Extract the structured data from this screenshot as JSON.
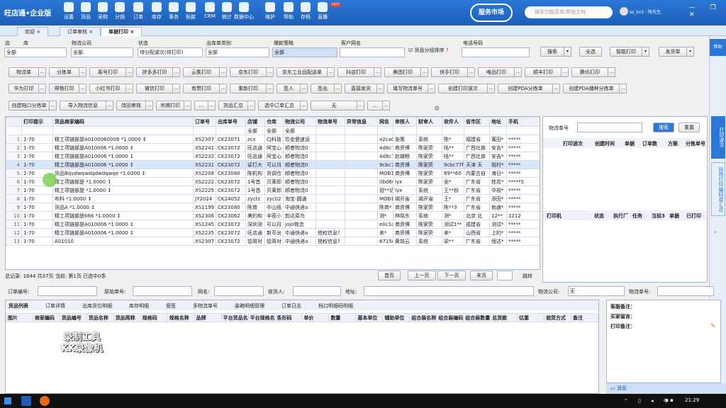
{
  "app": {
    "logo": "旺店通•企业版",
    "hot_badge": "HOT",
    "service_badge": "服务市场",
    "search_placeholder": "搜索功能菜单/帮助文档",
    "user": "ss_kn2 · 陈先生",
    "window_controls": "— ❐ ✕"
  },
  "nav": [
    "设置",
    "货品",
    "采购",
    "分销",
    "订单",
    "库存",
    "事务",
    "账款",
    "CRM",
    "统计",
    "数据中心",
    "维护",
    "帮助",
    "存档",
    "直播"
  ],
  "tabs": [
    "欢迎",
    "订单审核",
    "单据打印"
  ],
  "filters": {
    "shop_label": "店",
    "shop_value": "全部",
    "warehouse_label": "库",
    "courier_label": "物流公司",
    "courier_value": "全部",
    "status_label": "状态",
    "status_value": "待分配波次(待打印)",
    "out_type_label": "出库单类别",
    "out_type_value": "全部",
    "strategy_label": "爆款策略",
    "strategy_value": "全部",
    "customer_label": "客户网名",
    "customer_value": "",
    "group_sort": "货品分组排序",
    "phone_label": "电话号码",
    "phone_value": ""
  },
  "top_buttons": [
    "搜索",
    "全选",
    "智能打印",
    "发货单",
    "帮助"
  ],
  "btnrow1": [
    "物流单",
    "分拣单",
    "筹号打印",
    "拼多多打印",
    "云集打印",
    "京东打印",
    "京东工业品配送单",
    "抖店打印",
    "美团打印",
    "快手打印",
    "唯品打印",
    "顺丰打印",
    "腾讯打印"
  ],
  "btnrow2": [
    "华为打印",
    "得物打印",
    "小红书打印",
    "微信打印",
    "有赞打印",
    "重新打印",
    "签入",
    "签出",
    "直接发货",
    "填写物流单号",
    "创建打印波次",
    "创建PDA分拣单",
    "创建PDA播种分拣单"
  ],
  "btnrow3": [
    "创建档口分拣单",
    "导入物流信息",
    "改回审核",
    "吊牌打印",
    "...",
    "货品汇总",
    "选中订单汇总",
    "无",
    "..."
  ],
  "grid": {
    "headers": [
      "",
      "打印提示",
      "货品商家编码",
      "订单号",
      "出库单号",
      "店铺",
      "仓库",
      "物流公司",
      "物流单号",
      "异常信息",
      "网名",
      "审核人",
      "财审人",
      "收件人",
      "省市区",
      "地址",
      "手机"
    ],
    "filter_row": [
      "",
      "",
      "",
      "",
      "",
      "全部",
      "全部",
      "全部",
      "",
      "",
      "",
      "",
      "",
      "",
      "",
      "",
      ""
    ],
    "rows": [
      [
        "1",
        "1-70",
        "精工项链部是A0100060008 *1.0000 ↕",
        "XS2307",
        "CK23071",
        "zcx",
        "CJ科技",
        "珍金健速运",
        "",
        "",
        "a2ca0",
        "张策",
        "系统",
        "陈*",
        "福建省",
        "莆田*",
        "*****"
      ],
      [
        "2",
        "1-70",
        "精工项链部是A010006 *1.0000 ↕",
        "XS2241",
        "CK23072",
        "旺店通",
        "阿宝心",
        "顺者物流0",
        "",
        "",
        "4d8c7",
        "商资博",
        "陈家荧",
        "陆**",
        "广西壮族",
        "安吉*",
        "*****"
      ],
      [
        "3",
        "1-70",
        "精工项链部是A010006 *1.0000 ↕",
        "XS2232",
        "CK23072",
        "旺店通",
        "阿宝心",
        "顺者物流0",
        "",
        "",
        "4d8c7",
        "赵雄畅",
        "陈家荧",
        "陆**",
        "广西壮族",
        "安吉*",
        "*****"
      ],
      [
        "4",
        "1-70",
        "精工项链部是A010006 *1.0000 ↕",
        "XS2231",
        "CK23072",
        "娑打大",
        "可以月",
        "顺者物流0",
        "",
        "",
        "9cbc7",
        "商资博",
        "陈家荧",
        "9cbc77f",
        "天津 天",
        "祖村*",
        "*****"
      ],
      [
        "5",
        "1-70",
        "货品Bqvdwqwdqdwdqwqe *1.0000 ↕",
        "XS2208",
        "CK23080",
        "陈机构",
        "货调仓",
        "顺者物流0",
        "",
        "",
        "MOB12",
        "商资博",
        "陈家荧",
        "89**60",
        "内蒙古自",
        "海日*",
        "*****"
      ],
      [
        "6",
        "1-70",
        "精工项链部是 *1.0000 ↕",
        "XS2222",
        "CK23072",
        "1号首",
        "贝莱即",
        "顺者物流0",
        "",
        "",
        "0bd60",
        "lyx",
        "陈家荧",
        "张*",
        "广东省",
        "桂花*",
        "*****5"
      ],
      [
        "7",
        "1-70",
        "精工项链部是 *1.0000 ↕",
        "XS2225",
        "CK23072",
        "1号首",
        "贝莱即",
        "顺者物流0",
        "",
        "",
        "冠**访",
        "lyx",
        "系统",
        "王**份",
        "广东省",
        "华视*",
        "*****"
      ],
      [
        "8",
        "1-70",
        "布料 *1.0000 ↕",
        "JY2024",
        "CK24052",
        "zyctz",
        "zyc02",
        "淘宝-圆通",
        "",
        "",
        "MOB16",
        "竭开宙",
        "竭开宙",
        "王*",
        "广东省",
        "添田*",
        "*****"
      ],
      [
        "9",
        "1-70",
        "货品A *1.0000 ↕",
        "XS1199",
        "CK23080",
        "陈商",
        "中山纸",
        "中通快递a",
        "",
        "",
        "陈商*",
        "商资博",
        "陈家荧",
        "陈**3",
        "广东省",
        "勃速*",
        "*****"
      ],
      [
        "10",
        "1-70",
        "精工项链部是666 *1.0000 ↕",
        "XS2306",
        "CK23062",
        "美的和",
        "丰密小",
        "韵达菜鸟",
        "",
        "",
        "测*",
        "林晓东",
        "系统",
        "测*",
        "北京 北",
        "12**",
        "1212"
      ],
      [
        "11",
        "1-70",
        "精工项链部是A010006 *1.0000 ↕",
        "XS1245",
        "CK23072",
        "深圳测",
        "可以月",
        "jojo物流",
        "",
        "",
        "e0c1c",
        "商资博",
        "陈家荧",
        "测试1**",
        "福建省",
        "测试*",
        "*****"
      ],
      [
        "12",
        "1-70",
        "精工项链部是A010006 *1.0000 ↕",
        "XS2235",
        "CK23072",
        "旺店通",
        "新币出",
        "中通快递a",
        "授权信息?",
        "",
        "来*",
        "商资博",
        "陈家荧",
        "来*",
        "山西省",
        "上的*",
        "*****"
      ],
      [
        "13",
        "1-70",
        "A01010",
        "XS2307",
        "CK23072",
        "铝哥对",
        "铝哥对",
        "中通快递a",
        "授权信息?",
        "",
        "6715c",
        "黄铭云",
        "系统",
        "梁**",
        "广东省",
        "恒达*",
        "*****"
      ]
    ]
  },
  "pager": {
    "summary": "总记录: 1644  共37页  当前: 第1页  已选中0条",
    "buttons": [
      "首页",
      "上一页",
      "下一页",
      "末页",
      "跳转"
    ]
  },
  "right_panel": {
    "label": "物流单号",
    "search": "搜索",
    "reset": "重置",
    "headers1": [
      "打印波次",
      "创建时间",
      "单据",
      "订单数",
      "方案",
      "分拣单号"
    ],
    "headers2": [
      "打印机",
      "状态",
      "执行厂",
      "任务",
      "当前3",
      "单据",
      "已打印"
    ]
  },
  "side_tabs": [
    "打印波次",
    "回传打印编码单汇总"
  ],
  "searchbar": {
    "order_no": "订单编号:",
    "raw_no": "原始单号:",
    "name": "网名:",
    "receiver": "收货人:",
    "address": "地址:",
    "courier": "物流公司:",
    "courier_value": "无",
    "logistics_no": "物流单号:"
  },
  "bottom_tabs": [
    "货品列表",
    "订单详情",
    "出库货位明细",
    "库存明细",
    "便签",
    "多物流单号",
    "装箱明细管理",
    "订单日志",
    "档口明细码明细"
  ],
  "bottom_headers": [
    "图片",
    "商家编码",
    "货品编号",
    "货品名称",
    "货品简称",
    "规格码",
    "规格名称",
    "品牌",
    "平台货品名称",
    "平台规格名称",
    "条形码",
    "单价",
    "数量",
    "基本单位",
    "辅助单位",
    "组合装名称",
    "组合装编码",
    "组合装数量",
    "总货款",
    "估重",
    "验货方式",
    "备注"
  ],
  "notes": [
    "客服备注：",
    "买家留言：",
    "打印备注："
  ],
  "msg": "消息",
  "watermark": [
    "录制工具",
    "KK录像机"
  ],
  "taskbar": {
    "time": "21:29"
  },
  "colors": {
    "accent": "#1d5fb8",
    "selected_row": "#d7e6fb"
  }
}
